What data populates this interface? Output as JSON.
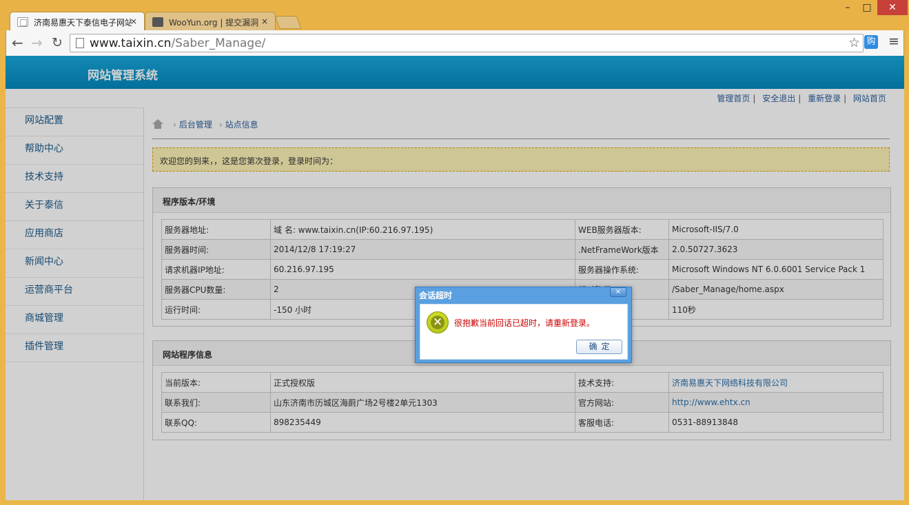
{
  "browser": {
    "tabs": [
      {
        "title": "济南易惠天下泰信电子网站",
        "close": "×"
      },
      {
        "title": "WooYun.org | 提交漏洞",
        "close": "×"
      }
    ],
    "url_host": "www.taixin.cn",
    "url_path": "/Saber_Manage/",
    "ext_label": "购"
  },
  "header": {
    "title": "网站管理系统"
  },
  "toplinks": [
    "管理首页",
    "安全退出",
    "重新登录",
    "网站首页"
  ],
  "sidebar": {
    "items": [
      "网站配置",
      "帮助中心",
      "技术支持",
      "关于泰信",
      "应用商店",
      "新闻中心",
      "运营商平台",
      "商城管理",
      "插件管理"
    ]
  },
  "breadcrumb": {
    "level1": "后台管理",
    "level2": "站点信息"
  },
  "welcome": "欢迎您的到来，，这是您第次登录，登录时间为：",
  "env_box": {
    "title": "程序版本/环境",
    "rows": [
      [
        "服务器地址:",
        "域 名: www.taixin.cn(IP:60.216.97.195)",
        "WEB服务器版本:",
        "Microsoft-IIS/7.0"
      ],
      [
        "服务器时间:",
        "2014/12/8 17:19:27",
        ".NetFrameWork版本",
        "2.0.50727.3623"
      ],
      [
        "请求机器IP地址:",
        "60.216.97.195",
        "服务器操作系统:",
        "Microsoft Windows NT 6.0.6001 Service Pack 1"
      ],
      [
        "服务器CPU数量:",
        "2",
        "相对路径:",
        "/Saber_Manage/home.aspx"
      ],
      [
        "运行时间:",
        "-150 小时",
        "",
        "110秒"
      ]
    ]
  },
  "info_box": {
    "title": "网站程序信息",
    "rows": [
      [
        "当前版本:",
        "正式授权版",
        "技术支持:",
        "济南易惠天下网络科技有限公司"
      ],
      [
        "联系我们:",
        "山东济南市历城区海蔚广场2号楼2单元1303",
        "官方网站:",
        "http://www.ehtx.cn"
      ],
      [
        "联系QQ:",
        "898235449",
        "客服电话:",
        "0531-88913848"
      ]
    ]
  },
  "dialog": {
    "title": "会话超时",
    "message": "很抱歉当前回话已超时，请重新登录。",
    "ok": "确定",
    "close": "×"
  }
}
